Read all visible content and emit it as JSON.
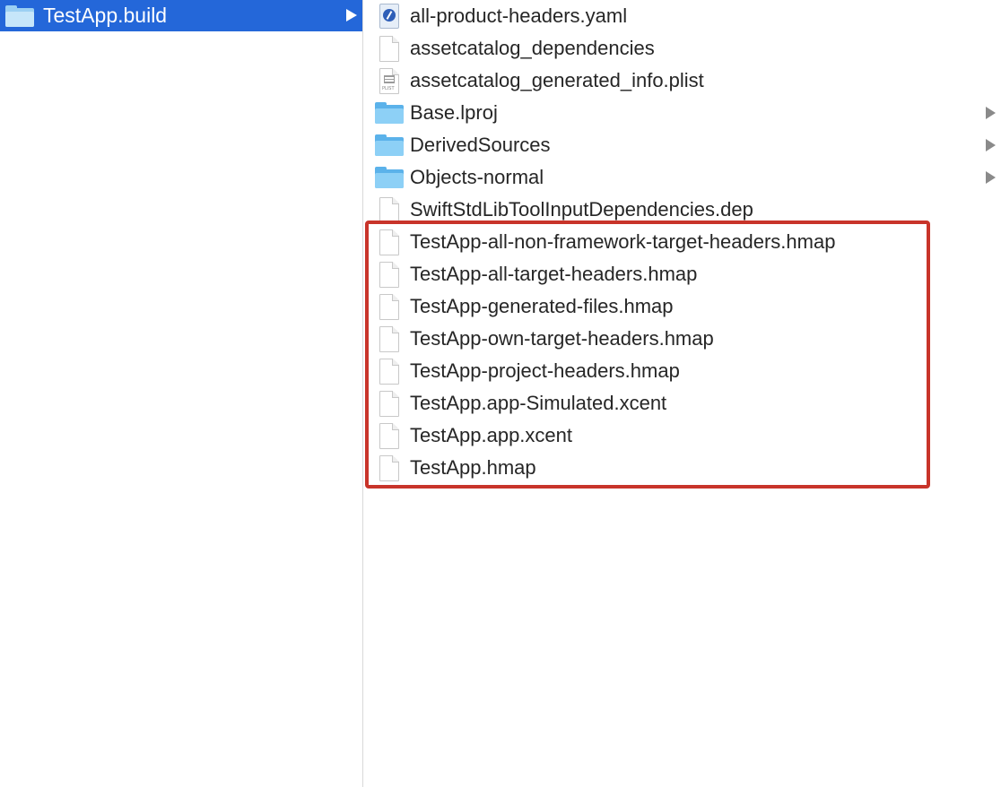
{
  "left_column": {
    "selected_item": {
      "label": "TestApp.build",
      "icon": "folder-icon"
    }
  },
  "right_column": {
    "items": [
      {
        "label": "all-product-headers.yaml",
        "icon": "yaml-file-icon",
        "has_children": false
      },
      {
        "label": "assetcatalog_dependencies",
        "icon": "document-icon",
        "has_children": false
      },
      {
        "label": "assetcatalog_generated_info.plist",
        "icon": "plist-file-icon",
        "has_children": false
      },
      {
        "label": "Base.lproj",
        "icon": "folder-icon",
        "has_children": true
      },
      {
        "label": "DerivedSources",
        "icon": "folder-icon",
        "has_children": true
      },
      {
        "label": "Objects-normal",
        "icon": "folder-icon",
        "has_children": true
      },
      {
        "label": "SwiftStdLibToolInputDependencies.dep",
        "icon": "document-icon",
        "has_children": false
      },
      {
        "label": "TestApp-all-non-framework-target-headers.hmap",
        "icon": "document-icon",
        "has_children": false
      },
      {
        "label": "TestApp-all-target-headers.hmap",
        "icon": "document-icon",
        "has_children": false
      },
      {
        "label": "TestApp-generated-files.hmap",
        "icon": "document-icon",
        "has_children": false
      },
      {
        "label": "TestApp-own-target-headers.hmap",
        "icon": "document-icon",
        "has_children": false
      },
      {
        "label": "TestApp-project-headers.hmap",
        "icon": "document-icon",
        "has_children": false
      },
      {
        "label": "TestApp.app-Simulated.xcent",
        "icon": "document-icon",
        "has_children": false
      },
      {
        "label": "TestApp.app.xcent",
        "icon": "document-icon",
        "has_children": false
      },
      {
        "label": "TestApp.hmap",
        "icon": "document-icon",
        "has_children": false
      }
    ]
  },
  "colors": {
    "selection": "#2467d9",
    "highlight_box": "#c8342a",
    "folder": "#5bb2ea"
  }
}
